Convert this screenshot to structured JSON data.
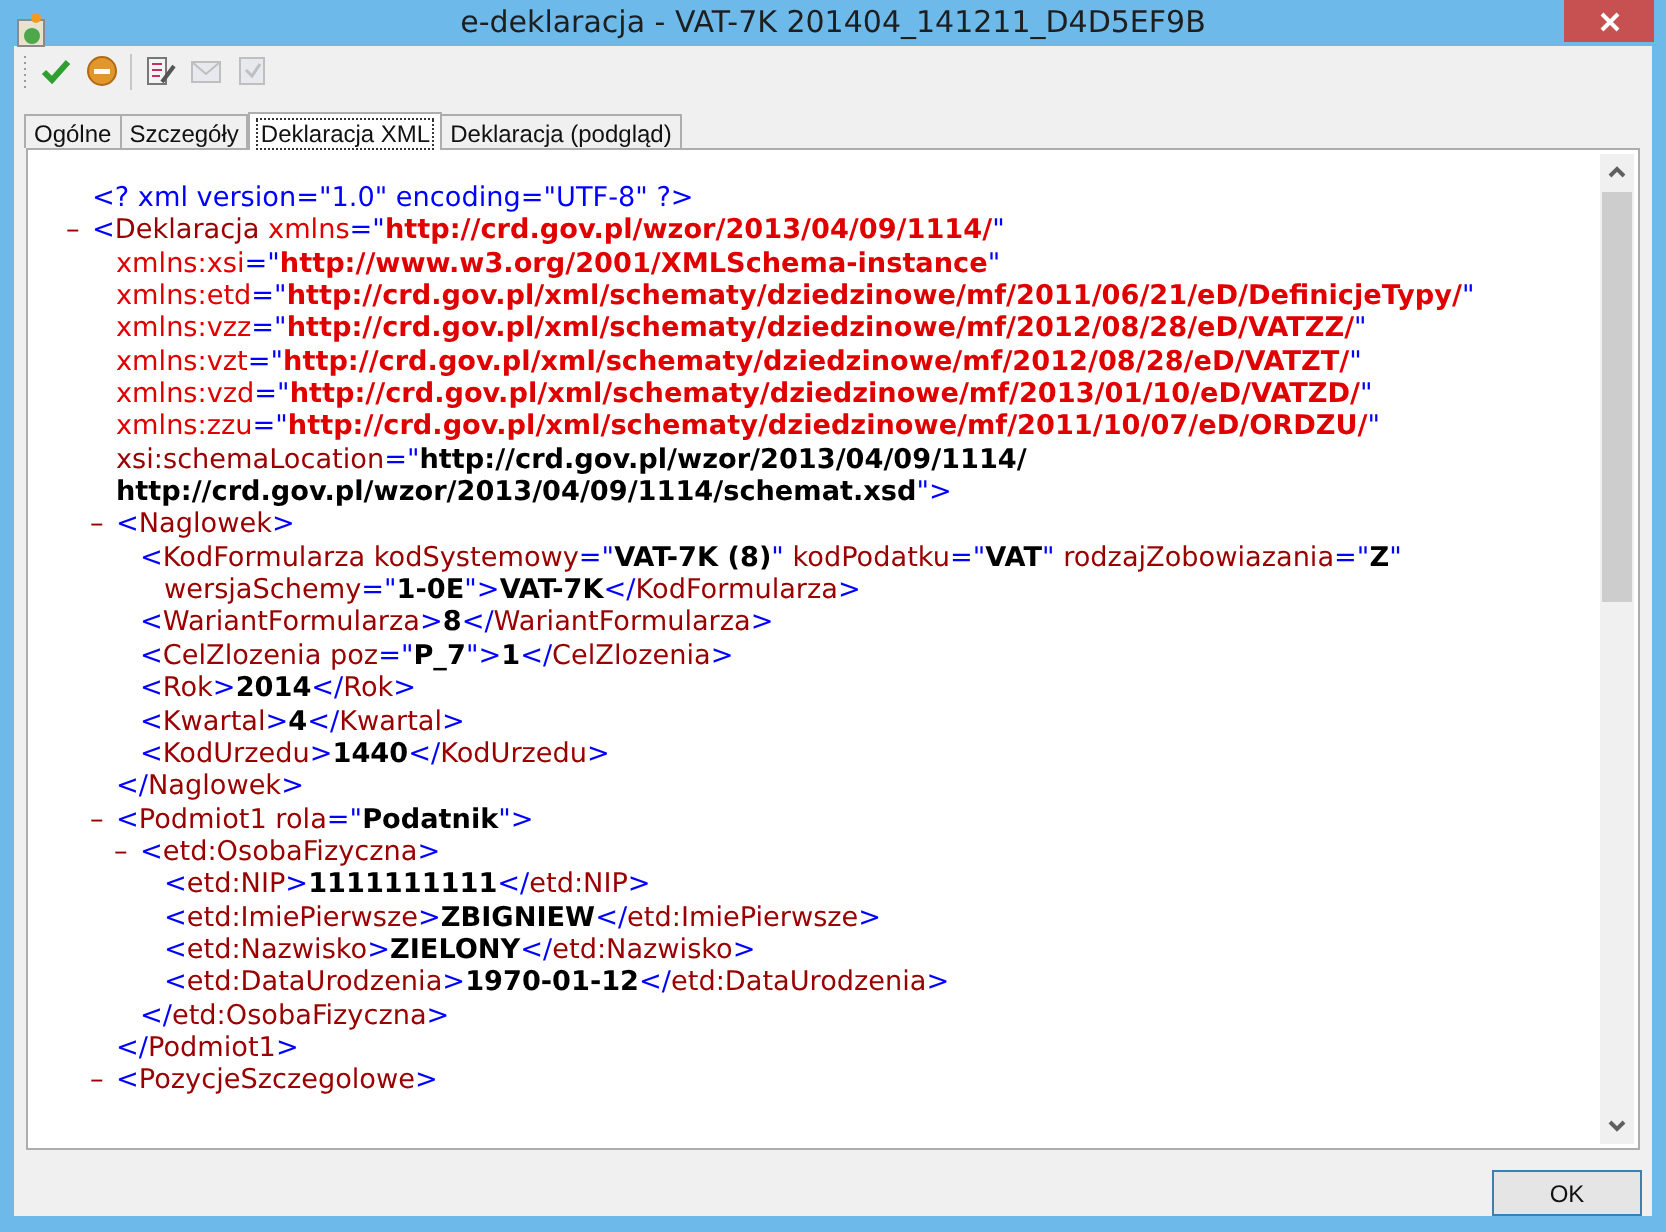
{
  "window": {
    "title": "e-deklaracja - VAT-7K 201404_141211_D4D5EF9B"
  },
  "toolbar": [
    {
      "kind": "check",
      "disabled": false
    },
    {
      "kind": "stop",
      "disabled": false
    },
    {
      "kind": "edit",
      "disabled": false
    },
    {
      "kind": "send",
      "disabled": true
    },
    {
      "kind": "receive",
      "disabled": true
    }
  ],
  "tabs": [
    {
      "label": "Ogólne",
      "selected": false
    },
    {
      "label": "Szczegóły",
      "selected": false
    },
    {
      "label": "Deklaracja XML",
      "selected": true
    },
    {
      "label": "Deklaracja (podgląd)",
      "selected": false
    }
  ],
  "xml": {
    "declaration": "<? xml version=\"1.0\" encoding=\"UTF-8\" ?>",
    "root": {
      "toggle": "–",
      "expanded": true,
      "lines": [
        [
          {
            "kind": "punct",
            "text": "<"
          },
          {
            "kind": "name",
            "text": "Deklaracja"
          },
          {
            "kind": "attr",
            "text": " xmlns"
          },
          {
            "kind": "punct",
            "text": "=\""
          },
          {
            "kind": "nsvalue",
            "text": "http://crd.gov.pl/wzor/2013/04/09/1114/"
          },
          {
            "kind": "punct",
            "text": "\""
          }
        ],
        [
          {
            "kind": "attr",
            "text": "xmlns:xsi"
          },
          {
            "kind": "punct",
            "text": "=\""
          },
          {
            "kind": "nsvalue",
            "text": "http://www.w3.org/2001/XMLSchema-instance"
          },
          {
            "kind": "punct",
            "text": "\""
          }
        ],
        [
          {
            "kind": "attr",
            "text": "xmlns:etd"
          },
          {
            "kind": "punct",
            "text": "=\""
          },
          {
            "kind": "nsvalue",
            "text": "http://crd.gov.pl/xml/schematy/dziedzinowe/mf/2011/06/21/eD/DefinicjeTypy/"
          },
          {
            "kind": "punct",
            "text": "\""
          }
        ],
        [
          {
            "kind": "attr",
            "text": "xmlns:vzz"
          },
          {
            "kind": "punct",
            "text": "=\""
          },
          {
            "kind": "nsvalue",
            "text": "http://crd.gov.pl/xml/schematy/dziedzinowe/mf/2012/08/28/eD/VATZZ/"
          },
          {
            "kind": "punct",
            "text": "\""
          }
        ],
        [
          {
            "kind": "attr",
            "text": "xmlns:vzt"
          },
          {
            "kind": "punct",
            "text": "=\""
          },
          {
            "kind": "nsvalue",
            "text": "http://crd.gov.pl/xml/schematy/dziedzinowe/mf/2012/08/28/eD/VATZT/"
          },
          {
            "kind": "punct",
            "text": "\""
          }
        ],
        [
          {
            "kind": "attr",
            "text": "xmlns:vzd"
          },
          {
            "kind": "punct",
            "text": "=\""
          },
          {
            "kind": "nsvalue",
            "text": "http://crd.gov.pl/xml/schematy/dziedzinowe/mf/2013/01/10/eD/VATZD/"
          },
          {
            "kind": "punct",
            "text": "\""
          }
        ],
        [
          {
            "kind": "attr",
            "text": "xmlns:zzu"
          },
          {
            "kind": "punct",
            "text": "=\""
          },
          {
            "kind": "nsvalue",
            "text": "http://crd.gov.pl/xml/schematy/dziedzinowe/mf/2011/10/07/eD/ORDZU/"
          },
          {
            "kind": "punct",
            "text": "\""
          }
        ],
        [
          {
            "kind": "name",
            "text": "xsi:schemaLocation"
          },
          {
            "kind": "punct",
            "text": "=\""
          },
          {
            "kind": "value",
            "text": "http://crd.gov.pl/wzor/2013/04/09/1114/"
          }
        ],
        [
          {
            "kind": "value",
            "text": "http://crd.gov.pl/wzor/2013/04/09/1114/schemat.xsd"
          },
          {
            "kind": "punct",
            "text": "\">"
          }
        ]
      ],
      "children": [
        {
          "toggle": "–",
          "expanded": true,
          "lines": [
            [
              {
                "kind": "punct",
                "text": "<"
              },
              {
                "kind": "name",
                "text": "Naglowek"
              },
              {
                "kind": "punct",
                "text": ">"
              }
            ]
          ],
          "children": [
            {
              "lines": [
                [
                  {
                    "kind": "punct",
                    "text": "<"
                  },
                  {
                    "kind": "name",
                    "text": "KodFormularza kodSystemowy"
                  },
                  {
                    "kind": "punct",
                    "text": "=\""
                  },
                  {
                    "kind": "value",
                    "text": "VAT-7K (8)"
                  },
                  {
                    "kind": "punct",
                    "text": "\""
                  },
                  {
                    "kind": "name",
                    "text": " kodPodatku"
                  },
                  {
                    "kind": "punct",
                    "text": "=\""
                  },
                  {
                    "kind": "value",
                    "text": "VAT"
                  },
                  {
                    "kind": "punct",
                    "text": "\""
                  },
                  {
                    "kind": "name",
                    "text": " rodzajZobowiazania"
                  },
                  {
                    "kind": "punct",
                    "text": "=\""
                  },
                  {
                    "kind": "value",
                    "text": "Z"
                  },
                  {
                    "kind": "punct",
                    "text": "\""
                  }
                ],
                [
                  {
                    "kind": "name",
                    "text": "wersjaSchemy"
                  },
                  {
                    "kind": "punct",
                    "text": "=\""
                  },
                  {
                    "kind": "value",
                    "text": "1-0E"
                  },
                  {
                    "kind": "punct",
                    "text": "\">"
                  },
                  {
                    "kind": "value",
                    "text": "VAT-7K"
                  },
                  {
                    "kind": "punct",
                    "text": "</"
                  },
                  {
                    "kind": "name",
                    "text": "KodFormularza"
                  },
                  {
                    "kind": "punct",
                    "text": ">"
                  }
                ]
              ]
            },
            {
              "lines": [
                [
                  {
                    "kind": "punct",
                    "text": "<"
                  },
                  {
                    "kind": "name",
                    "text": "WariantFormularza"
                  },
                  {
                    "kind": "punct",
                    "text": ">"
                  },
                  {
                    "kind": "value",
                    "text": "8"
                  },
                  {
                    "kind": "punct",
                    "text": "</"
                  },
                  {
                    "kind": "name",
                    "text": "WariantFormularza"
                  },
                  {
                    "kind": "punct",
                    "text": ">"
                  }
                ]
              ]
            },
            {
              "lines": [
                [
                  {
                    "kind": "punct",
                    "text": "<"
                  },
                  {
                    "kind": "name",
                    "text": "CelZlozenia poz"
                  },
                  {
                    "kind": "punct",
                    "text": "=\""
                  },
                  {
                    "kind": "value",
                    "text": "P_7"
                  },
                  {
                    "kind": "punct",
                    "text": "\">"
                  },
                  {
                    "kind": "value",
                    "text": "1"
                  },
                  {
                    "kind": "punct",
                    "text": "</"
                  },
                  {
                    "kind": "name",
                    "text": "CelZlozenia"
                  },
                  {
                    "kind": "punct",
                    "text": ">"
                  }
                ]
              ]
            },
            {
              "lines": [
                [
                  {
                    "kind": "punct",
                    "text": "<"
                  },
                  {
                    "kind": "name",
                    "text": "Rok"
                  },
                  {
                    "kind": "punct",
                    "text": ">"
                  },
                  {
                    "kind": "value",
                    "text": "2014"
                  },
                  {
                    "kind": "punct",
                    "text": "</"
                  },
                  {
                    "kind": "name",
                    "text": "Rok"
                  },
                  {
                    "kind": "punct",
                    "text": ">"
                  }
                ]
              ]
            },
            {
              "lines": [
                [
                  {
                    "kind": "punct",
                    "text": "<"
                  },
                  {
                    "kind": "name",
                    "text": "Kwartal"
                  },
                  {
                    "kind": "punct",
                    "text": ">"
                  },
                  {
                    "kind": "value",
                    "text": "4"
                  },
                  {
                    "kind": "punct",
                    "text": "</"
                  },
                  {
                    "kind": "name",
                    "text": "Kwartal"
                  },
                  {
                    "kind": "punct",
                    "text": ">"
                  }
                ]
              ]
            },
            {
              "lines": [
                [
                  {
                    "kind": "punct",
                    "text": "<"
                  },
                  {
                    "kind": "name",
                    "text": "KodUrzedu"
                  },
                  {
                    "kind": "punct",
                    "text": ">"
                  },
                  {
                    "kind": "value",
                    "text": "1440"
                  },
                  {
                    "kind": "punct",
                    "text": "</"
                  },
                  {
                    "kind": "name",
                    "text": "KodUrzedu"
                  },
                  {
                    "kind": "punct",
                    "text": ">"
                  }
                ]
              ]
            }
          ],
          "closing": [
            {
              "kind": "punct",
              "text": "</"
            },
            {
              "kind": "name",
              "text": "Naglowek"
            },
            {
              "kind": "punct",
              "text": ">"
            }
          ]
        },
        {
          "toggle": "–",
          "expanded": true,
          "lines": [
            [
              {
                "kind": "punct",
                "text": "<"
              },
              {
                "kind": "name",
                "text": "Podmiot1 rola"
              },
              {
                "kind": "punct",
                "text": "=\""
              },
              {
                "kind": "value",
                "text": "Podatnik"
              },
              {
                "kind": "punct",
                "text": "\">"
              }
            ]
          ],
          "children": [
            {
              "toggle": "–",
              "expanded": true,
              "lines": [
                [
                  {
                    "kind": "punct",
                    "text": "<"
                  },
                  {
                    "kind": "name",
                    "text": "etd:OsobaFizyczna"
                  },
                  {
                    "kind": "punct",
                    "text": ">"
                  }
                ]
              ],
              "children": [
                {
                  "lines": [
                    [
                      {
                        "kind": "punct",
                        "text": "<"
                      },
                      {
                        "kind": "name",
                        "text": "etd:NIP"
                      },
                      {
                        "kind": "punct",
                        "text": ">"
                      },
                      {
                        "kind": "value",
                        "text": "1111111111"
                      },
                      {
                        "kind": "punct",
                        "text": "</"
                      },
                      {
                        "kind": "name",
                        "text": "etd:NIP"
                      },
                      {
                        "kind": "punct",
                        "text": ">"
                      }
                    ]
                  ]
                },
                {
                  "lines": [
                    [
                      {
                        "kind": "punct",
                        "text": "<"
                      },
                      {
                        "kind": "name",
                        "text": "etd:ImiePierwsze"
                      },
                      {
                        "kind": "punct",
                        "text": ">"
                      },
                      {
                        "kind": "value",
                        "text": "ZBIGNIEW"
                      },
                      {
                        "kind": "punct",
                        "text": "</"
                      },
                      {
                        "kind": "name",
                        "text": "etd:ImiePierwsze"
                      },
                      {
                        "kind": "punct",
                        "text": ">"
                      }
                    ]
                  ]
                },
                {
                  "lines": [
                    [
                      {
                        "kind": "punct",
                        "text": "<"
                      },
                      {
                        "kind": "name",
                        "text": "etd:Nazwisko"
                      },
                      {
                        "kind": "punct",
                        "text": ">"
                      },
                      {
                        "kind": "value",
                        "text": "ZIELONY"
                      },
                      {
                        "kind": "punct",
                        "text": "</"
                      },
                      {
                        "kind": "name",
                        "text": "etd:Nazwisko"
                      },
                      {
                        "kind": "punct",
                        "text": ">"
                      }
                    ]
                  ]
                },
                {
                  "lines": [
                    [
                      {
                        "kind": "punct",
                        "text": "<"
                      },
                      {
                        "kind": "name",
                        "text": "etd:DataUrodzenia"
                      },
                      {
                        "kind": "punct",
                        "text": ">"
                      },
                      {
                        "kind": "value",
                        "text": "1970-01-12"
                      },
                      {
                        "kind": "punct",
                        "text": "</"
                      },
                      {
                        "kind": "name",
                        "text": "etd:DataUrodzenia"
                      },
                      {
                        "kind": "punct",
                        "text": ">"
                      }
                    ]
                  ]
                }
              ],
              "closing": [
                {
                  "kind": "punct",
                  "text": "</"
                },
                {
                  "kind": "name",
                  "text": "etd:OsobaFizyczna"
                },
                {
                  "kind": "punct",
                  "text": ">"
                }
              ]
            }
          ],
          "closing": [
            {
              "kind": "punct",
              "text": "</"
            },
            {
              "kind": "name",
              "text": "Podmiot1"
            },
            {
              "kind": "punct",
              "text": ">"
            }
          ]
        },
        {
          "toggle": "–",
          "expanded": true,
          "lines": [
            [
              {
                "kind": "punct",
                "text": "<"
              },
              {
                "kind": "name",
                "text": "PozycjeSzczegolowe"
              },
              {
                "kind": "punct",
                "text": ">"
              }
            ]
          ]
        }
      ]
    }
  },
  "buttons": [
    {
      "label": "OK"
    }
  ]
}
